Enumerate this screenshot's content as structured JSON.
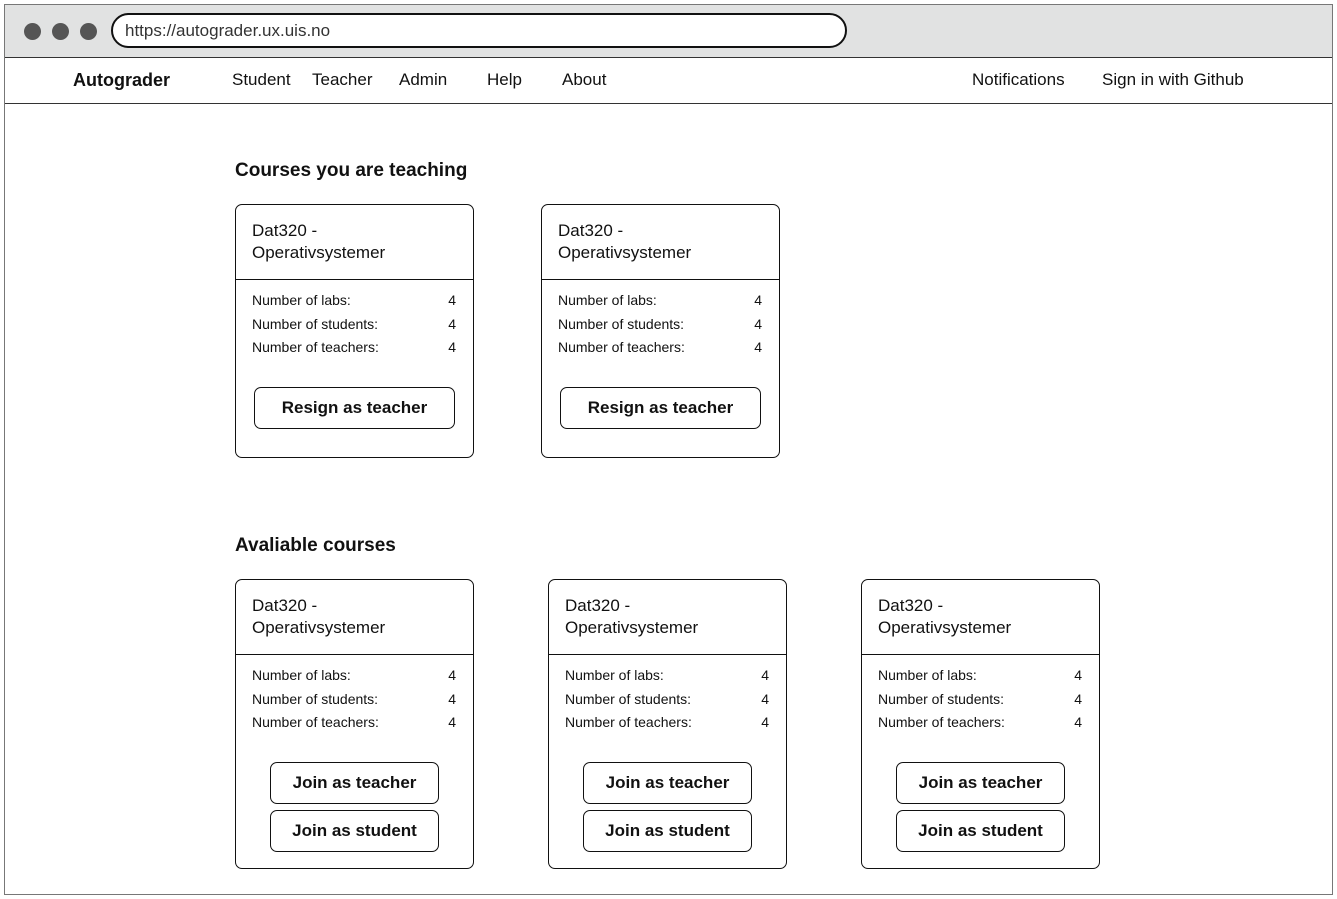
{
  "browser": {
    "url": "https://autograder.ux.uis.no"
  },
  "nav": {
    "brand": "Autograder",
    "items": [
      "Student",
      "Teacher",
      "Admin",
      "Help",
      "About"
    ],
    "notifications": "Notifications",
    "sign_in": "Sign in with Github"
  },
  "teaching": {
    "heading": "Courses you are teaching",
    "courses": [
      {
        "title_line1": "Dat320 -",
        "title_line2": "Operativsystemer",
        "stats": [
          {
            "label": "Number of labs:",
            "value": "4"
          },
          {
            "label": "Number  of students:",
            "value": "4"
          },
          {
            "label": "Number of teachers:",
            "value": "4"
          }
        ],
        "buttons": [
          "Resign as teacher"
        ]
      },
      {
        "title_line1": "Dat320 -",
        "title_line2": "Operativsystemer",
        "stats": [
          {
            "label": "Number of labs:",
            "value": "4"
          },
          {
            "label": "Number  of students:",
            "value": "4"
          },
          {
            "label": "Number of teachers:",
            "value": "4"
          }
        ],
        "buttons": [
          "Resign as teacher"
        ]
      }
    ]
  },
  "available": {
    "heading": "Avaliable courses",
    "courses": [
      {
        "title_line1": "Dat320 -",
        "title_line2": "Operativsystemer",
        "stats": [
          {
            "label": "Number of labs:",
            "value": "4"
          },
          {
            "label": "Number  of students:",
            "value": "4"
          },
          {
            "label": "Number of teachers:",
            "value": "4"
          }
        ],
        "buttons": [
          "Join as teacher",
          "Join as student"
        ]
      },
      {
        "title_line1": "Dat320 -",
        "title_line2": "Operativsystemer",
        "stats": [
          {
            "label": "Number of labs:",
            "value": "4"
          },
          {
            "label": "Number  of students:",
            "value": "4"
          },
          {
            "label": "Number of teachers:",
            "value": "4"
          }
        ],
        "buttons": [
          "Join as teacher",
          "Join as student"
        ]
      },
      {
        "title_line1": "Dat320 -",
        "title_line2": "Operativsystemer",
        "stats": [
          {
            "label": "Number of labs:",
            "value": "4"
          },
          {
            "label": "Number  of students:",
            "value": "4"
          },
          {
            "label": "Number of teachers:",
            "value": "4"
          }
        ],
        "buttons": [
          "Join as teacher",
          "Join as student"
        ]
      }
    ]
  }
}
